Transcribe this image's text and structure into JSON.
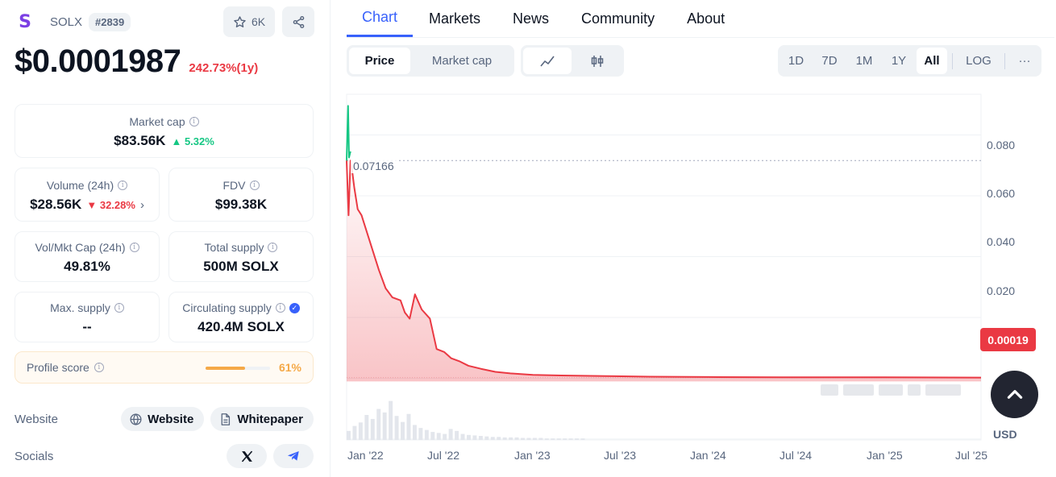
{
  "coin": {
    "logo_letter": "S",
    "symbol": "SOLX",
    "rank": "#2839",
    "watchlist_count": "6K",
    "price": "$0.0001987",
    "price_change": "242.73%(1y)"
  },
  "stats": {
    "market_cap": {
      "label": "Market cap",
      "value": "$83.56K",
      "change": "5.32%",
      "direction": "up"
    },
    "volume": {
      "label": "Volume (24h)",
      "value": "$28.56K",
      "change": "32.28%",
      "direction": "down"
    },
    "fdv": {
      "label": "FDV",
      "value": "$99.38K"
    },
    "vol_mkt_cap": {
      "label": "Vol/Mkt Cap (24h)",
      "value": "49.81%"
    },
    "total_supply": {
      "label": "Total supply",
      "value": "500M SOLX"
    },
    "max_supply": {
      "label": "Max. supply",
      "value": "--"
    },
    "circulating_supply": {
      "label": "Circulating supply",
      "value": "420.4M SOLX"
    }
  },
  "profile": {
    "label": "Profile score",
    "value": "61%",
    "fraction": 0.61
  },
  "links": {
    "website_label": "Website",
    "website_button": "Website",
    "whitepaper_button": "Whitepaper",
    "socials_label": "Socials"
  },
  "tabs": [
    "Chart",
    "Markets",
    "News",
    "Community",
    "About"
  ],
  "active_tab": "Chart",
  "chart_controls": {
    "metric": [
      "Price",
      "Market cap"
    ],
    "active_metric": "Price",
    "chart_styles": [
      "line-chart-icon",
      "candlestick-icon"
    ],
    "ranges": [
      "1D",
      "7D",
      "1M",
      "1Y",
      "All"
    ],
    "active_range": "All",
    "log_label": "LOG",
    "more_label": "···"
  },
  "chart_data": {
    "type": "line",
    "title": "",
    "currency_label": "USD",
    "x_tick_labels": [
      "Jan '22",
      "Jul '22",
      "Jan '23",
      "Jul '23",
      "Jan '24",
      "Jul '24",
      "Jan '25",
      "Jul '25"
    ],
    "y_tick_labels": [
      "0.080",
      "0.060",
      "0.040",
      "0.020"
    ],
    "ylim": [
      -0.0203,
      0.0934
    ],
    "max_price_label": "0.07166",
    "current_price_label": "0.00019",
    "series": [
      {
        "values_note": "",
        "x": [
          "2021-12-10",
          "2021-12-14",
          "2021-12-18",
          "2021-12-22",
          "2021-12-26",
          "2022-01-02",
          "2022-01-10",
          "2022-01-20",
          "2022-02-01",
          "2022-02-15",
          "2022-03-01",
          "2022-03-15",
          "2022-04-01",
          "2022-04-10",
          "2022-04-20",
          "2022-05-01",
          "2022-05-15",
          "2022-06-01",
          "2022-06-15",
          "2022-07-01",
          "2022-07-15",
          "2022-08-01",
          "2022-08-20",
          "2022-09-15",
          "2022-10-15",
          "2022-11-15",
          "2023-01-01",
          "2023-03-01",
          "2023-06-01",
          "2023-09-01",
          "2024-01-01",
          "2024-06-01",
          "2025-01-01",
          "2025-07-20"
        ],
        "y": [
          0.0716,
          0.0536,
          0.0716,
          0.0676,
          0.0626,
          0.0556,
          0.0536,
          0.0486,
          0.0426,
          0.0356,
          0.0296,
          0.0266,
          0.0256,
          0.0216,
          0.0196,
          0.0276,
          0.0226,
          0.0196,
          0.0096,
          0.0086,
          0.0066,
          0.0056,
          0.0041,
          0.0031,
          0.0021,
          0.0016,
          0.0011,
          0.0009,
          0.0007,
          0.0005,
          0.0004,
          0.0003,
          0.0003,
          0.0002
        ]
      },
      {
        "name": "",
        "x": [
          "2021-12-10",
          "2021-12-13",
          "2021-12-15",
          "2021-12-18"
        ],
        "y": [
          0.0716,
          0.0896,
          0.0726,
          0.0746
        ],
        "color": "#16c784"
      }
    ],
    "volume_bars": [
      0.18,
      0.28,
      0.35,
      0.5,
      0.42,
      0.62,
      0.55,
      0.78,
      0.48,
      0.36,
      0.52,
      0.3,
      0.24,
      0.2,
      0.16,
      0.14,
      0.12,
      0.22,
      0.18,
      0.12,
      0.1,
      0.09,
      0.08,
      0.07,
      0.06,
      0.06,
      0.05,
      0.05,
      0.05,
      0.04,
      0.04,
      0.04,
      0.04,
      0.03,
      0.03,
      0.03,
      0.03,
      0.03,
      0.03,
      0.03
    ]
  },
  "colors": {
    "accent": "#3861fb",
    "negative": "#ea3943",
    "positive": "#16c784",
    "profile": "#f5a948",
    "logo": "#7b3fe4"
  }
}
